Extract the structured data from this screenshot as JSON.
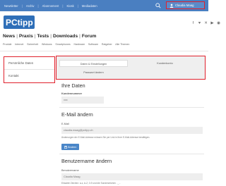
{
  "top_nav": {
    "items": [
      "Newsletter",
      "Archiv",
      "Abonnement",
      "Kiosk",
      "Mediadaten"
    ],
    "user_name": "Claudia Maag"
  },
  "logo": {
    "text": "PCtipp"
  },
  "main_nav": {
    "items": [
      "News",
      "Praxis",
      "Tests",
      "Downloads",
      "Forum"
    ]
  },
  "sub_nav": {
    "items": [
      "Produkt",
      "Internet",
      "Sicherheit",
      "Windows",
      "Smartphones",
      "Hardware",
      "Software",
      "Ratgeber",
      "Alle Themen"
    ]
  },
  "sidebar": {
    "items": [
      "Persönliche Daten",
      "Kontakt"
    ]
  },
  "tabs": {
    "items": [
      "Daten & Einstellungen",
      "Kundenkonto",
      "Passwort ändern"
    ]
  },
  "your_data": {
    "title": "Ihre Daten",
    "customer_number_label": "Kundennummer",
    "customer_number_value": "xxx"
  },
  "email_change": {
    "title": "E-Mail ändern",
    "email_label": "E-Mail",
    "email_value": "claudia.maag@pctipp.ch",
    "hint": "Änderungen der E-Mail-Adresse müssen Sie per Link in Ihrer E-Mail-Adresse bestätigen.",
    "save_label": "Ändern"
  },
  "username_change": {
    "title": "Benutzername ändern",
    "username_label": "Benutzername",
    "username_value": "Claudia Maag",
    "hint": "Erlaubte Zeichen: a-z, A-Z, 0-9 und die Sonderzeichen . _ -"
  },
  "colors": {
    "top_bar": "#4a7fc1",
    "highlight": "#e0202c",
    "button": "#4a86c8"
  },
  "icons": [
    "search-icon",
    "user-icon",
    "facebook-icon",
    "twitter-icon",
    "x-icon",
    "youtube-icon",
    "rss-icon",
    "save-icon"
  ]
}
